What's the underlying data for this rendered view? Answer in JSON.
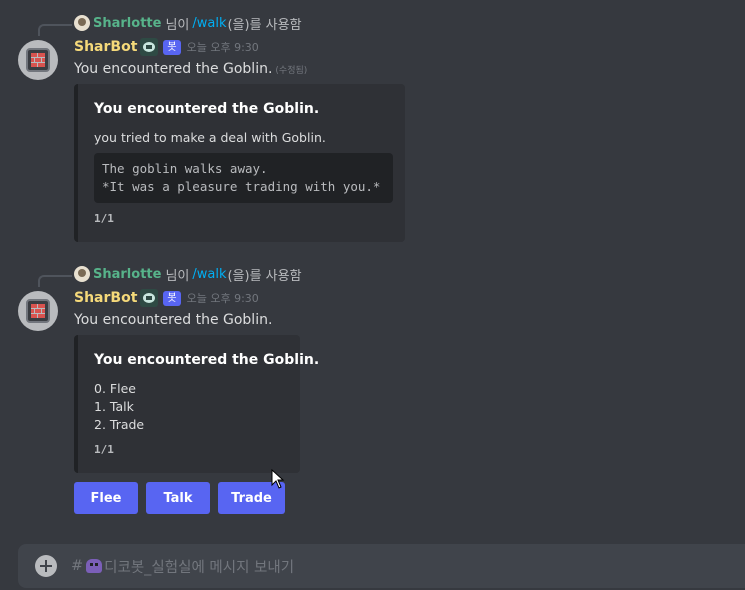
{
  "messages": [
    {
      "reply": {
        "user": "Sharlotte",
        "pre": "님이",
        "command": "/walk",
        "post": "(을)를 사용함"
      },
      "author": "SharBot",
      "bot_tag": "봇",
      "time": "오늘 오후 9:30",
      "content": "You encountered the Goblin.",
      "edited": "(수정됨)",
      "embed": {
        "title": "You encountered the Goblin.",
        "description": "you tried to make a deal with Goblin.",
        "code_lines": [
          "The goblin walks away.",
          "*It was a pleasure trading with you.*"
        ],
        "footer": "1/1"
      }
    },
    {
      "reply": {
        "user": "Sharlotte",
        "pre": "님이",
        "command": "/walk",
        "post": "(을)를 사용함"
      },
      "author": "SharBot",
      "bot_tag": "봇",
      "time": "오늘 오후 9:30",
      "content": "You encountered the Goblin.",
      "embed": {
        "title": "You encountered the Goblin.",
        "options": [
          "0. Flee",
          "1. Talk",
          "2. Trade"
        ],
        "footer": "1/1"
      },
      "buttons": [
        "Flee",
        "Talk",
        "Trade"
      ]
    }
  ],
  "composer": {
    "hash": "#",
    "placeholder": "디코봇_실험실에 메시지 보내기"
  },
  "colors": {
    "accent": "#5865f2",
    "background": "#36393f",
    "embed": "#2f3136",
    "username_bot": "#f5d97a",
    "username_user": "#57b38a",
    "command": "#00aff4"
  }
}
